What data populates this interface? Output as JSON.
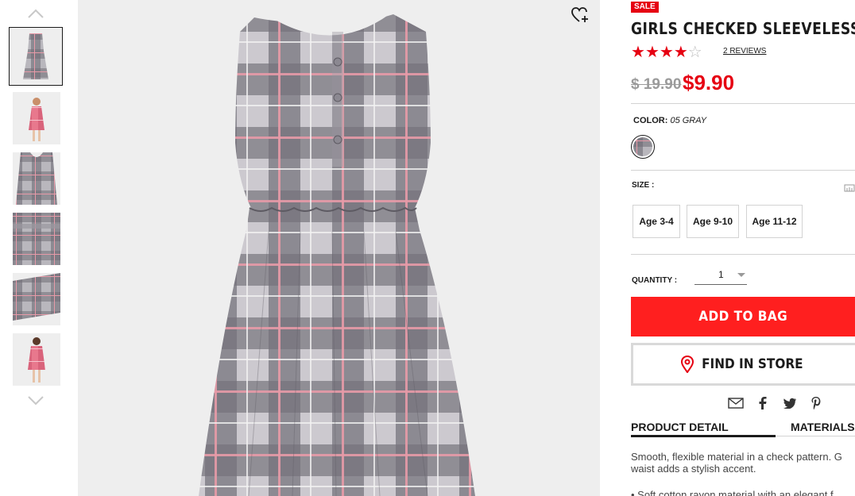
{
  "gallery": {
    "thumbnails": [
      {
        "name": "front view"
      },
      {
        "name": "model view"
      },
      {
        "name": "back view"
      },
      {
        "name": "skirt detail"
      },
      {
        "name": "hem detail"
      },
      {
        "name": "model back view"
      }
    ]
  },
  "product": {
    "badge": "SALE",
    "title": "GIRLS CHECKED SLEEVELESS DRESS",
    "rating": 4,
    "rating_max": 5,
    "reviews_label": "2 REVIEWS",
    "original_price": "$ 19.90",
    "sale_price": "$9.90",
    "color_label": "COLOR:",
    "color_value": "05 GRAY",
    "size_label": "SIZE :",
    "sizes": [
      "Age 3-4",
      "Age 9-10",
      "Age 11-12"
    ],
    "quantity_label": "QUANTITY :",
    "quantity_value": "1",
    "add_to_bag": "ADD TO BAG",
    "find_in_store": "FIND IN STORE",
    "tabs": [
      "PRODUCT DETAIL",
      "MATERIALS"
    ],
    "description_line1": "Smooth, flexible material in a check pattern. G",
    "description_line2": "waist adds a stylish accent.",
    "bullet_1": "• Soft cotton rayon material with an elegant f"
  },
  "colors": {
    "accent": "#e60012",
    "button_red": "#ff1f1f",
    "dress_gray": "#8a8790",
    "check_pink": "#e79aa8"
  },
  "icons": {
    "favorite": "heart-plus-icon",
    "share": [
      "mail-icon",
      "facebook-icon",
      "twitter-icon",
      "pinterest-icon"
    ],
    "location": "location-pin-icon"
  }
}
